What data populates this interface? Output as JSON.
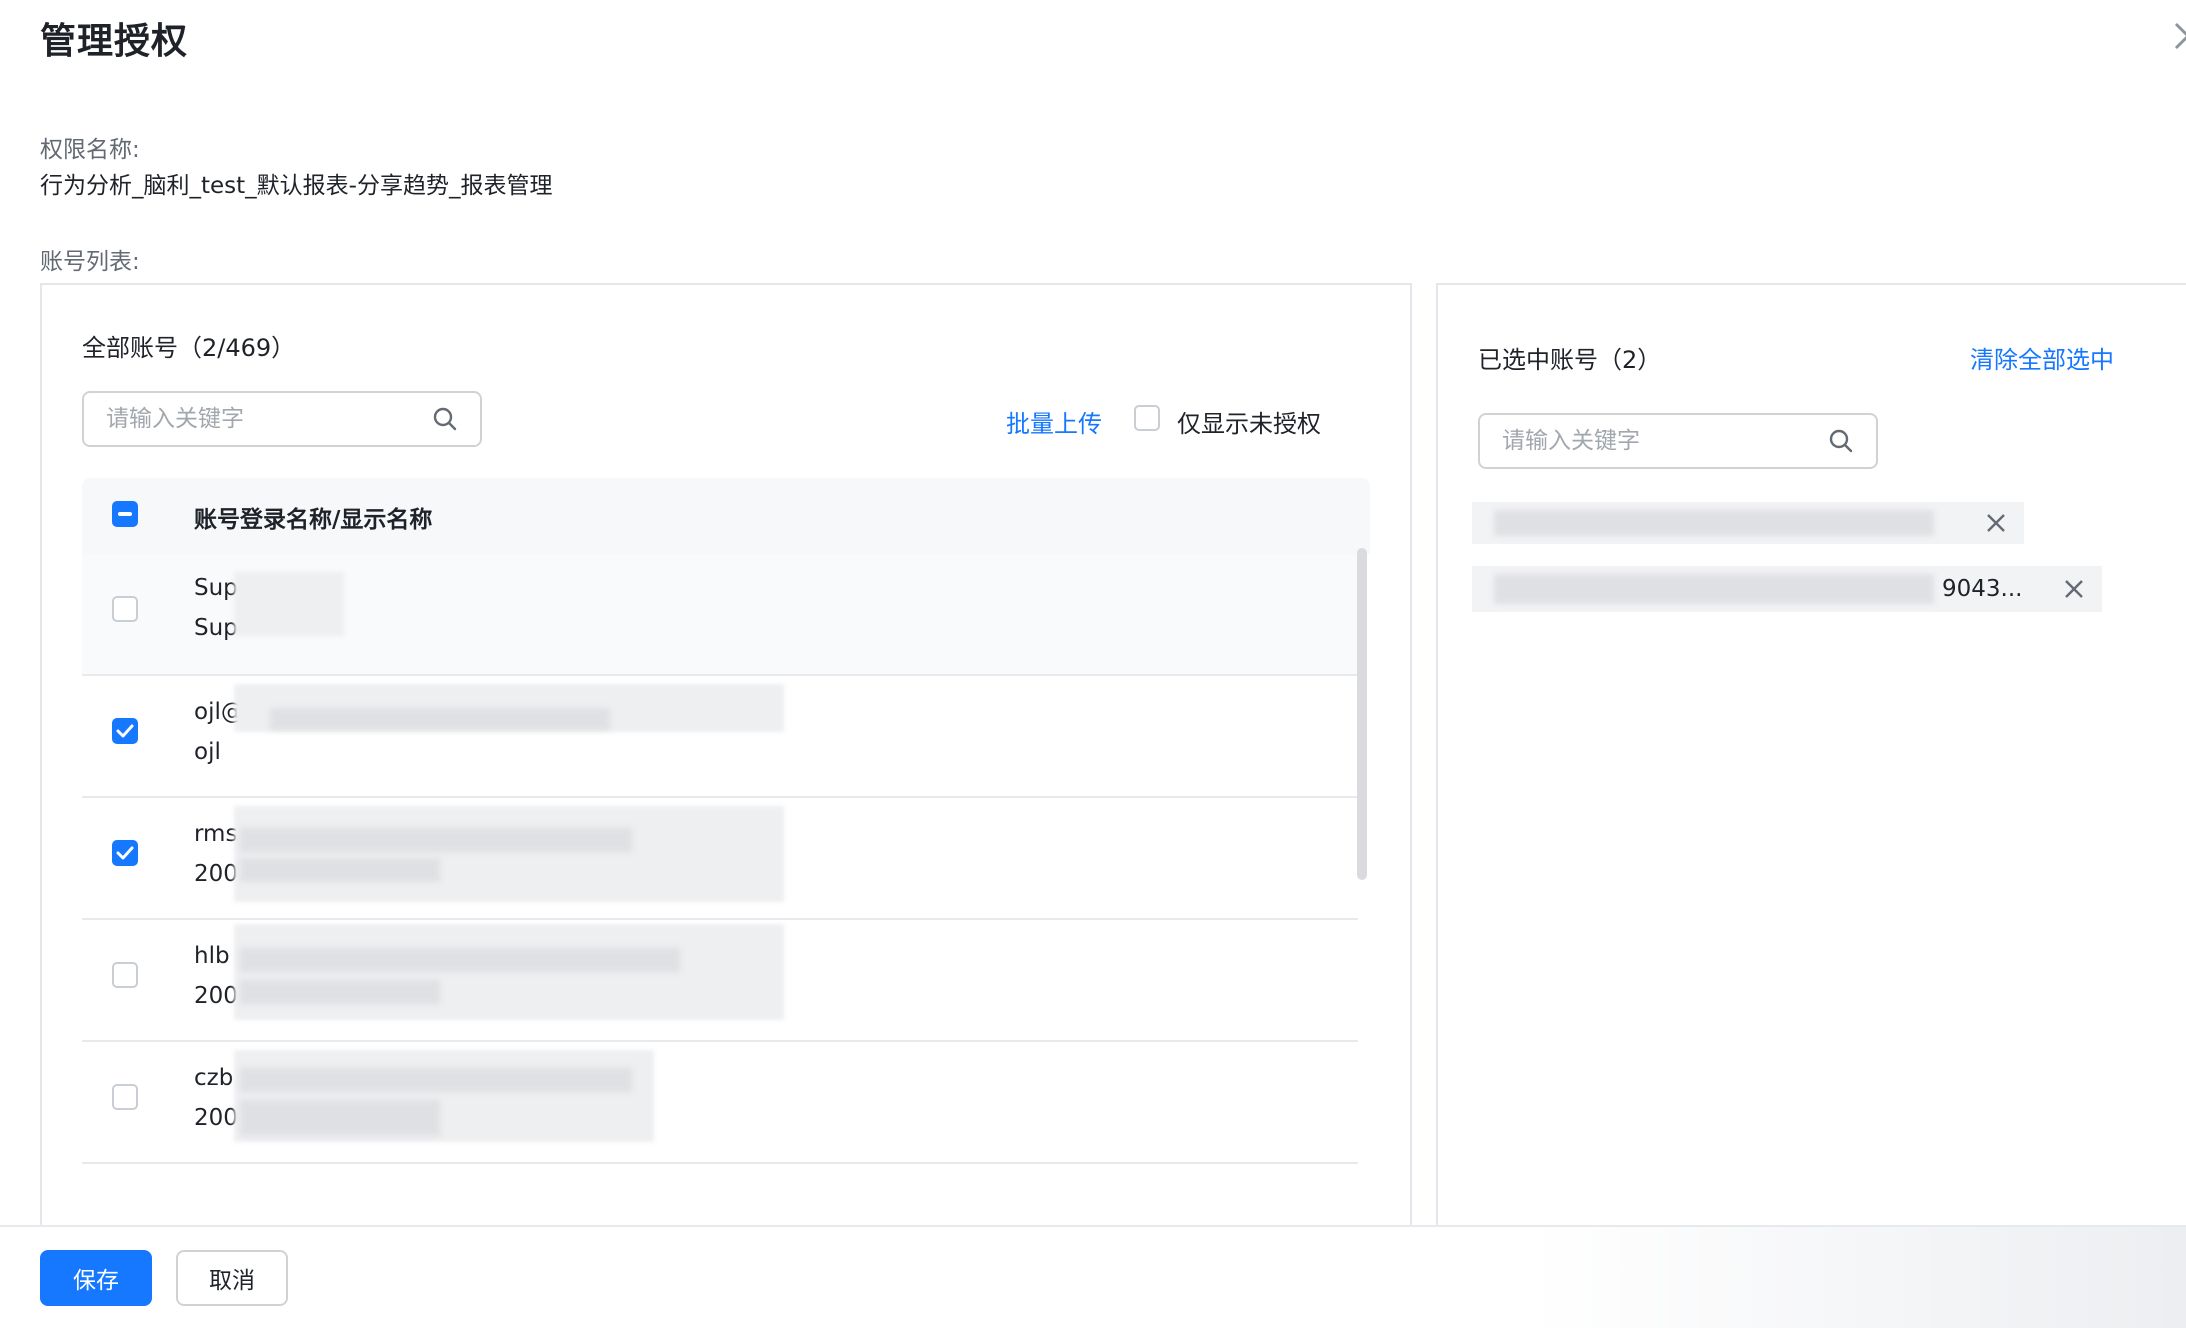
{
  "dialog": {
    "title": "管理授权",
    "close_icon": "close-icon"
  },
  "permission": {
    "label": "权限名称:",
    "value": "行为分析_脑利_test_默认报表-分享趋势_报表管理"
  },
  "accounts": {
    "label": "账号列表:"
  },
  "left_panel": {
    "title": "全部账号（2/469）",
    "search_placeholder": "请输入关键字",
    "batch_upload": "批量上传",
    "only_unauthorized": "仅显示未授权",
    "column_header": "账号登录名称/显示名称",
    "rows": [
      {
        "line1": "Sup",
        "line2": "Sup",
        "checked": false
      },
      {
        "line1": "ojl@",
        "line2": "ojl",
        "checked": true
      },
      {
        "line1": "rms",
        "line2": "200",
        "checked": true
      },
      {
        "line1": "hlb",
        "line2": "200",
        "checked": false
      },
      {
        "line1": "czb",
        "line2": "200",
        "checked": false
      }
    ]
  },
  "right_panel": {
    "title": "已选中账号（2）",
    "clear_all": "清除全部选中",
    "search_placeholder": "请输入关键字",
    "selected_tags": [
      {
        "text": ""
      },
      {
        "text": "9043..."
      }
    ]
  },
  "footer": {
    "save": "保存",
    "cancel": "取消"
  },
  "colors": {
    "primary": "#1677ff",
    "text": "#1f2329",
    "muted": "#646a73",
    "border": "#e5e6eb"
  }
}
